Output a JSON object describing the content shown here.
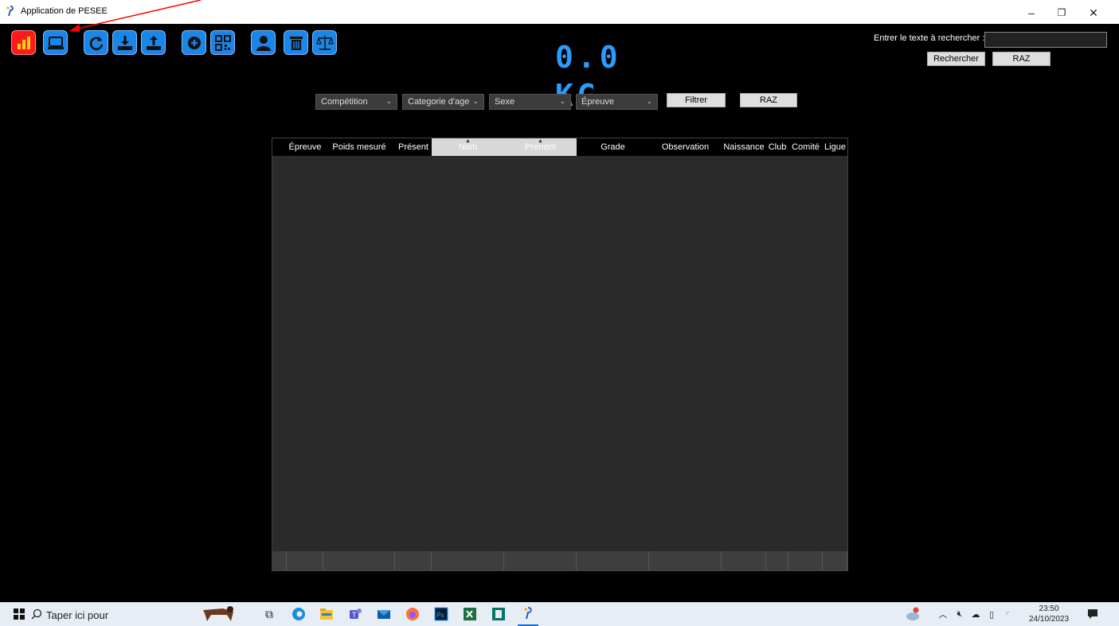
{
  "window": {
    "title": "Application de PESEE",
    "minimize": "–",
    "restore": "❐",
    "close": "✕"
  },
  "toolbar": {
    "buttons": [
      {
        "name": "stats",
        "icon": "bar-chart-icon",
        "color": "#ff1a1a"
      },
      {
        "name": "display",
        "icon": "monitor-icon",
        "color": "#1a86e8"
      },
      {
        "name": "refresh",
        "icon": "refresh-icon",
        "color": "#1a86e8"
      },
      {
        "name": "import",
        "icon": "download-icon",
        "color": "#1a86e8"
      },
      {
        "name": "export",
        "icon": "upload-icon",
        "color": "#1a86e8"
      },
      {
        "name": "add",
        "icon": "plus-circle-icon",
        "color": "#1a86e8"
      },
      {
        "name": "qrcode",
        "icon": "qr-code-icon",
        "color": "#1a86e8"
      },
      {
        "name": "user",
        "icon": "user-icon",
        "color": "#1a86e8"
      },
      {
        "name": "delete",
        "icon": "trash-icon",
        "color": "#1a86e8"
      },
      {
        "name": "balance",
        "icon": "scale-icon",
        "color": "#1a86e8"
      }
    ]
  },
  "weight_display": {
    "value": "0.0 KG",
    "color": "#2a9cff"
  },
  "search": {
    "label": "Entrer le texte à rechercher :",
    "value": "",
    "search_button": "Rechercher",
    "reset_button": "RAZ"
  },
  "filters": {
    "competition": "Compétition",
    "age_category": "Categorie d'age",
    "sex": "Sexe",
    "event": "Épreuve",
    "filter_button": "Filtrer",
    "reset_button": "RAZ"
  },
  "grid": {
    "columns": [
      {
        "label": "Épreuve",
        "sorted": false
      },
      {
        "label": "Poids mesuré",
        "sorted": false
      },
      {
        "label": "Présent",
        "sorted": false
      },
      {
        "label": "Nom",
        "sorted": true
      },
      {
        "label": "Prénom",
        "sorted": true
      },
      {
        "label": "Grade",
        "sorted": false
      },
      {
        "label": "Observation",
        "sorted": false
      },
      {
        "label": "Naissance",
        "sorted": false
      },
      {
        "label": "Club",
        "sorted": false
      },
      {
        "label": "Comité",
        "sorted": false
      },
      {
        "label": "Ligue",
        "sorted": false
      }
    ],
    "rows": []
  },
  "taskbar": {
    "search_placeholder": "Taper ici pour",
    "time": "23:50",
    "date": "24/10/2023",
    "apps": [
      "task-view-icon",
      "edge-icon",
      "explorer-icon",
      "teams-icon",
      "mail-icon",
      "firefox-icon",
      "photoshop-icon",
      "excel-icon",
      "publisher-icon",
      "pesee-app-icon"
    ]
  }
}
